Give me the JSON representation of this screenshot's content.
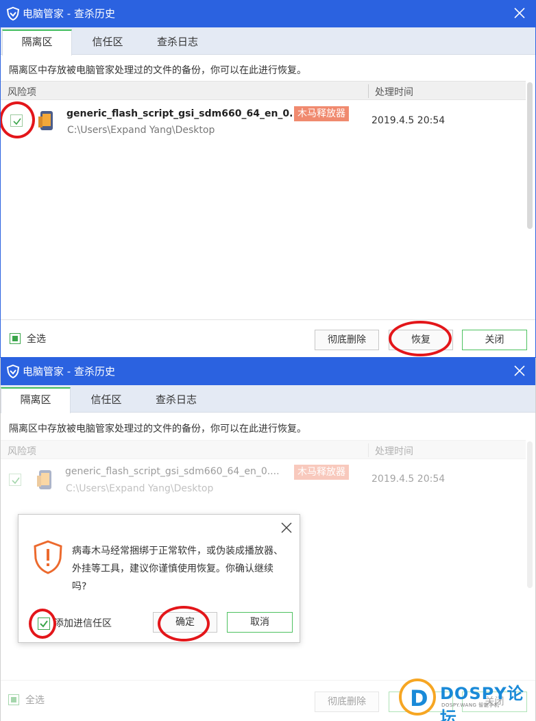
{
  "window_title": "电脑管家 - 查杀历史",
  "tabs": [
    "隔离区",
    "信任区",
    "查杀日志"
  ],
  "description": "隔离区中存放被电脑管家处理过的文件的备份，你可以在此进行恢复。",
  "columns": {
    "risk": "风险项",
    "time": "处理时间"
  },
  "item": {
    "name": "generic_flash_script_gsi_sdm660_64_en_0....",
    "path": "C:\\Users\\Expand Yang\\Desktop",
    "badge": "木马释放器",
    "time": "2019.4.5 20:54"
  },
  "footer": {
    "select_all": "全选",
    "delete_button": "彻底删除",
    "restore_button": "恢复",
    "close_button": "关闭"
  },
  "dialog": {
    "message": "病毒木马经常捆绑于正常软件，或伪装成播放器、外挂等工具，建议你谨慎使用恢复。你确认继续吗?",
    "add_trust_label": "添加进信任区",
    "confirm_button": "确定",
    "cancel_button": "取消"
  },
  "watermark": {
    "letter": "D",
    "brand": "DOSPY论坛",
    "sub": "DOSPY.WANG 智能手机"
  },
  "colors": {
    "titlebar": "#2b62e0",
    "tab_accent": "#3fbd5c",
    "badge": "#f08a6f",
    "annotation": "#e3161a",
    "check_green": "#3aa54a"
  }
}
